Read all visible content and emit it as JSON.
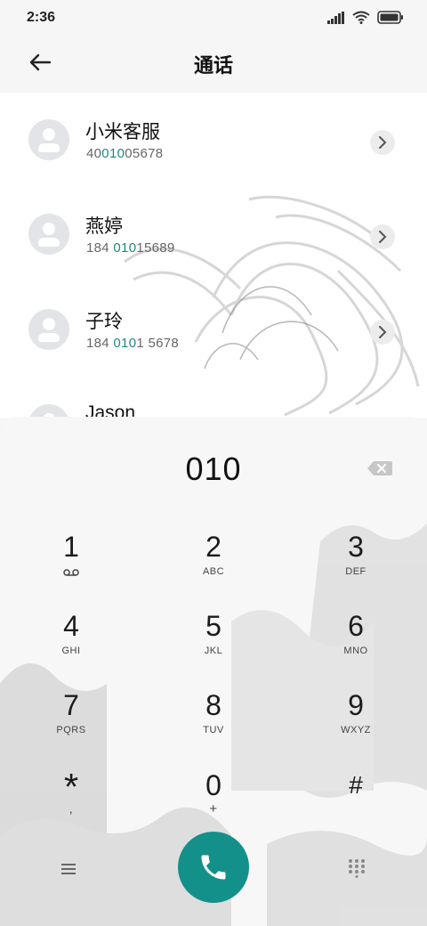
{
  "status": {
    "time": "2:36"
  },
  "header": {
    "title": "通话"
  },
  "contacts": [
    {
      "name": "小米客服",
      "num_pre": "40",
      "num_hl": "010",
      "num_post": "05678"
    },
    {
      "name": "燕婷",
      "num_pre": "184 ",
      "num_hl": "010",
      "num_post": "15689"
    },
    {
      "name": "子玲",
      "num_pre": "184 ",
      "num_hl": "010",
      "num_post": "1 5678"
    },
    {
      "name": "Jason",
      "num_pre": "",
      "num_hl": "",
      "num_post": ""
    }
  ],
  "dialer": {
    "input": "010",
    "keys": [
      {
        "num": "1",
        "letters": ""
      },
      {
        "num": "2",
        "letters": "ABC"
      },
      {
        "num": "3",
        "letters": "DEF"
      },
      {
        "num": "4",
        "letters": "GHI"
      },
      {
        "num": "5",
        "letters": "JKL"
      },
      {
        "num": "6",
        "letters": "MNO"
      },
      {
        "num": "7",
        "letters": "PQRS"
      },
      {
        "num": "8",
        "letters": "TUV"
      },
      {
        "num": "9",
        "letters": "WXYZ"
      },
      {
        "num": "*",
        "letters": ","
      },
      {
        "num": "0",
        "letters": "+"
      },
      {
        "num": "#",
        "letters": ""
      }
    ]
  },
  "colors": {
    "accent": "#14908a",
    "highlight": "#1a8a82"
  },
  "icons": {
    "back": "back-arrow-icon",
    "delete": "backspace-icon",
    "call": "phone-icon",
    "menu": "menu-icon",
    "keypad": "keypad-icon",
    "voicemail": "voicemail-icon"
  }
}
